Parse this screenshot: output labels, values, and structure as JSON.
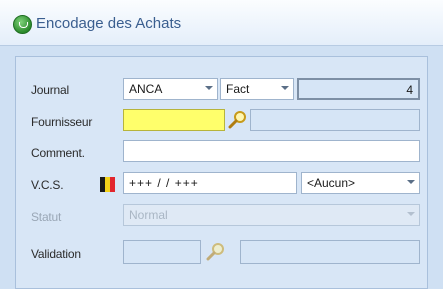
{
  "window": {
    "title": "Encodage des Achats"
  },
  "form": {
    "journal": {
      "label": "Journal",
      "combo1": "ANCA",
      "combo2": "Fact",
      "number": "4"
    },
    "fournisseur": {
      "label": "Fournisseur",
      "value": "",
      "name": ""
    },
    "comment": {
      "label": "Comment.",
      "value": ""
    },
    "vcs": {
      "label": "V.C.S.",
      "value": "+++ / / +++",
      "combo": "<Aucun>"
    },
    "statut": {
      "label": "Statut",
      "value": "Normal"
    },
    "validation": {
      "label": "Validation",
      "value": "",
      "name": ""
    }
  },
  "colors": {
    "accent_yellow": "#ffff6b",
    "panel_blue": "#d8e6f6",
    "title_text": "#3a5e8f"
  },
  "icons": {
    "app": "green-circle-app-icon",
    "search": "magnifier-icon",
    "flag": "belgian-flag-icon"
  }
}
